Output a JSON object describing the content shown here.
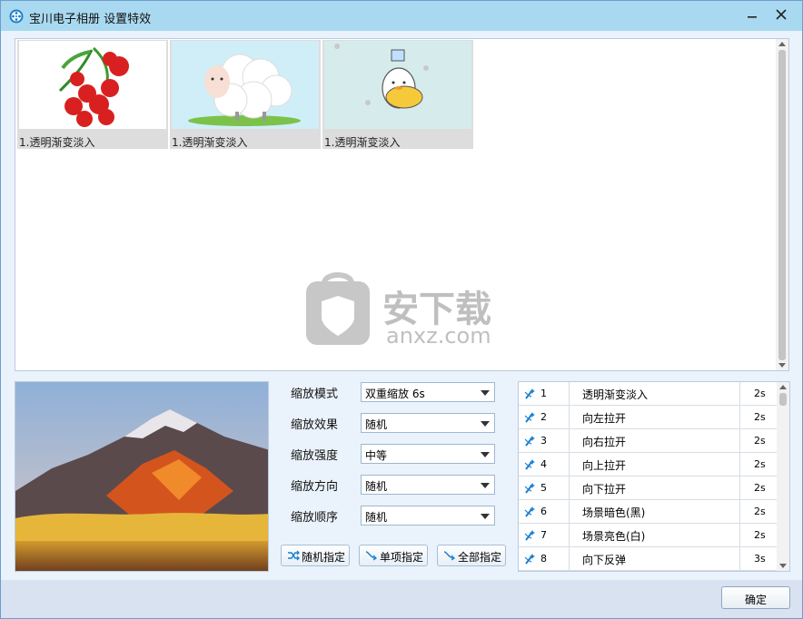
{
  "window": {
    "title": "宝川电子相册 设置特效",
    "icons": {
      "app": "film-reel-icon",
      "minimize": "minimize-icon",
      "close": "close-icon"
    }
  },
  "gallery": {
    "thumbnails": [
      {
        "caption": "1.透明渐变淡入",
        "image": "lychee-fruit-image"
      },
      {
        "caption": "1.透明渐变淡入",
        "image": "cartoon-sheep-image"
      },
      {
        "caption": "1.透明渐变淡入",
        "image": "cartoon-duck-image"
      }
    ],
    "watermark": {
      "text": "安下载",
      "domain": "anxz.com"
    }
  },
  "preview": {
    "image": "mountain-lake-landscape"
  },
  "settings": {
    "fields": [
      {
        "label": "缩放模式",
        "value": "双重缩放 6s"
      },
      {
        "label": "缩放效果",
        "value": "随机"
      },
      {
        "label": "缩放强度",
        "value": "中等"
      },
      {
        "label": "缩放方向",
        "value": "随机"
      },
      {
        "label": "缩放顺序",
        "value": "随机"
      }
    ],
    "buttons": {
      "random": "随机指定",
      "single": "单项指定",
      "all": "全部指定"
    }
  },
  "effects": [
    {
      "num": "1",
      "name": "透明渐变淡入",
      "duration": "2s"
    },
    {
      "num": "2",
      "name": "向左拉开",
      "duration": "2s"
    },
    {
      "num": "3",
      "name": "向右拉开",
      "duration": "2s"
    },
    {
      "num": "4",
      "name": "向上拉开",
      "duration": "2s"
    },
    {
      "num": "5",
      "name": "向下拉开",
      "duration": "2s"
    },
    {
      "num": "6",
      "name": "场景暗色(黑)",
      "duration": "2s"
    },
    {
      "num": "7",
      "name": "场景亮色(白)",
      "duration": "2s"
    },
    {
      "num": "8",
      "name": "向下反弹",
      "duration": "3s"
    }
  ],
  "footer": {
    "ok": "确定"
  },
  "colors": {
    "accent": "#1a7fd0",
    "titlebar": "#a9d9f1",
    "window_bg": "#eaf3fb"
  }
}
